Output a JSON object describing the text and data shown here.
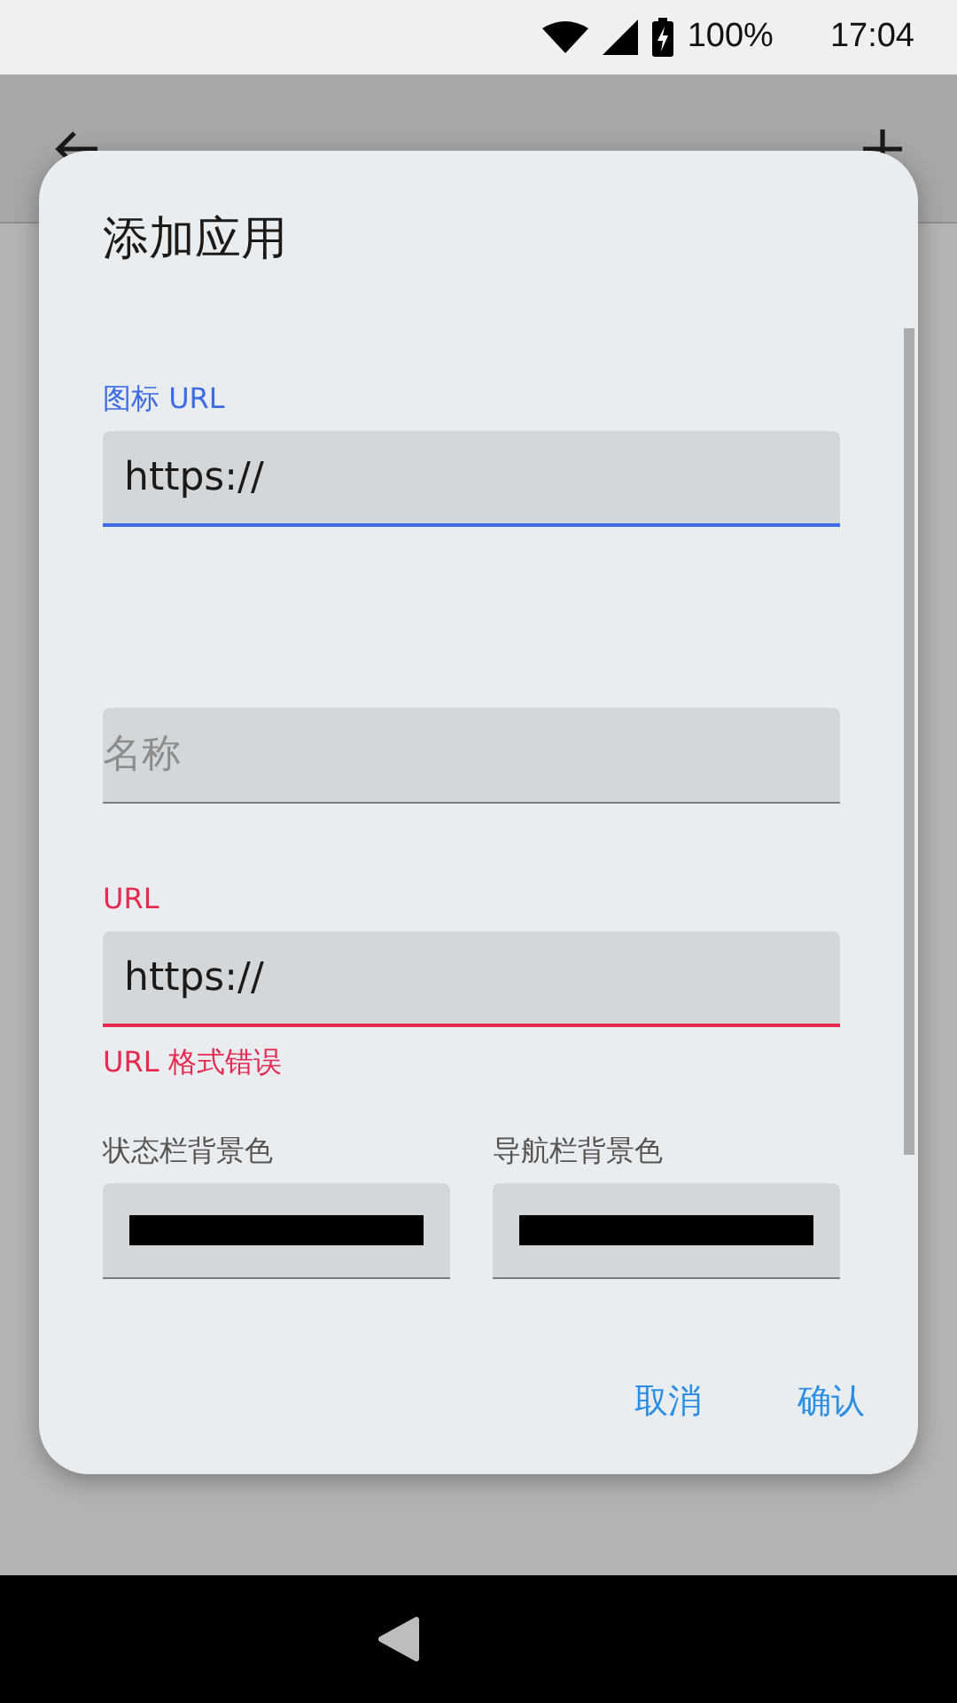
{
  "status_bar": {
    "battery": "100%",
    "time": "17:04"
  },
  "dialog": {
    "title": "添加应用",
    "fields": [
      {
        "kind": "text",
        "label": "图标 URL",
        "value": "https://",
        "focused": true,
        "error": false
      },
      {
        "kind": "text",
        "placeholder": "名称",
        "focused": false,
        "error": false
      },
      {
        "kind": "text",
        "label": "URL",
        "value": "https://",
        "focused": false,
        "error": true,
        "error_text": "URL 格式错误"
      }
    ],
    "colors": [
      {
        "label": "状态栏背景色",
        "color": "#000000"
      },
      {
        "label": "导航栏背景色",
        "color": "#000000"
      }
    ],
    "buttons": [
      "取消",
      "确认"
    ]
  }
}
